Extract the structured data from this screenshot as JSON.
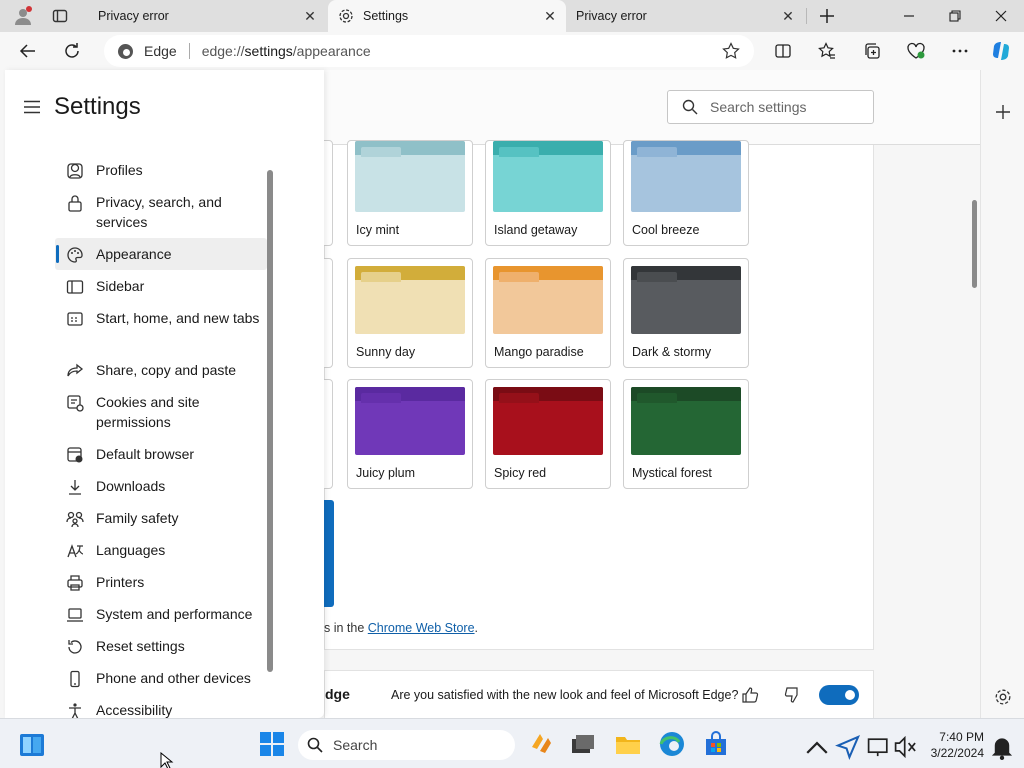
{
  "browser": {
    "tabs": [
      {
        "title": "Privacy error",
        "active": false
      },
      {
        "title": "Settings",
        "active": true
      },
      {
        "title": "Privacy error",
        "active": false
      }
    ],
    "address": {
      "site_label": "Edge",
      "url_scheme": "edge://",
      "url_path": "settings",
      "url_rest": "/appearance"
    }
  },
  "settings": {
    "title": "Settings",
    "search_placeholder": "Search settings",
    "nav": [
      {
        "label": "Profiles",
        "icon": "profile-icon"
      },
      {
        "label": "Privacy, search, and services",
        "icon": "lock-icon"
      },
      {
        "label": "Appearance",
        "icon": "palette-icon",
        "active": true
      },
      {
        "label": "Sidebar",
        "icon": "sidebar-icon"
      },
      {
        "label": "Start, home, and new tabs",
        "icon": "home-tabs-icon"
      },
      {
        "label": "Share, copy and paste",
        "icon": "share-icon"
      },
      {
        "label": "Cookies and site permissions",
        "icon": "cookies-icon"
      },
      {
        "label": "Default browser",
        "icon": "browser-icon"
      },
      {
        "label": "Downloads",
        "icon": "download-icon"
      },
      {
        "label": "Family safety",
        "icon": "family-icon"
      },
      {
        "label": "Languages",
        "icon": "language-icon"
      },
      {
        "label": "Printers",
        "icon": "printer-icon"
      },
      {
        "label": "System and performance",
        "icon": "laptop-icon"
      },
      {
        "label": "Reset settings",
        "icon": "reset-icon"
      },
      {
        "label": "Phone and other devices",
        "icon": "phone-icon"
      },
      {
        "label": "Accessibility",
        "icon": "accessibility-icon"
      }
    ]
  },
  "themes": [
    {
      "label": "Icy mint",
      "bar": "#8fc0c8",
      "body": "#c8e2e6",
      "tab": "#b0d3d9"
    },
    {
      "label": "Island getaway",
      "bar": "#3aaead",
      "body": "#77d4d4",
      "tab": "#56c2c2"
    },
    {
      "label": "Cool breeze",
      "bar": "#6a9cc8",
      "body": "#a6c4de",
      "tab": "#8fb4d6"
    },
    {
      "label": "Sunny day",
      "bar": "#d2ad3a",
      "body": "#f0e0b4",
      "tab": "#e6d08a"
    },
    {
      "label": "Mango paradise",
      "bar": "#e8952e",
      "body": "#f2c89a",
      "tab": "#efb06c"
    },
    {
      "label": "Dark & stormy",
      "bar": "#333639",
      "body": "#585b5f",
      "tab": "#4a4d50"
    },
    {
      "label": "Juicy plum",
      "bar": "#5a2aa0",
      "body": "#7038b8",
      "tab": "#6530ac"
    },
    {
      "label": "Spicy red",
      "bar": "#7a0c14",
      "body": "#a8101c",
      "tab": "#951019"
    },
    {
      "label": "Mystical forest",
      "bar": "#1c4a26",
      "body": "#246634",
      "tab": "#20582c"
    }
  ],
  "webstore": {
    "prefix": "s in the ",
    "link": "Chrome Web Store",
    "suffix": "."
  },
  "feedback": {
    "brand_fragment": "dge",
    "question": "Are you satisfied with the new look and feel of Microsoft Edge?",
    "toggle_on": true
  },
  "taskbar": {
    "search_label": "Search",
    "time": "7:40 PM",
    "date": "3/22/2024"
  },
  "colors": {
    "accent": "#0f6cbd"
  }
}
